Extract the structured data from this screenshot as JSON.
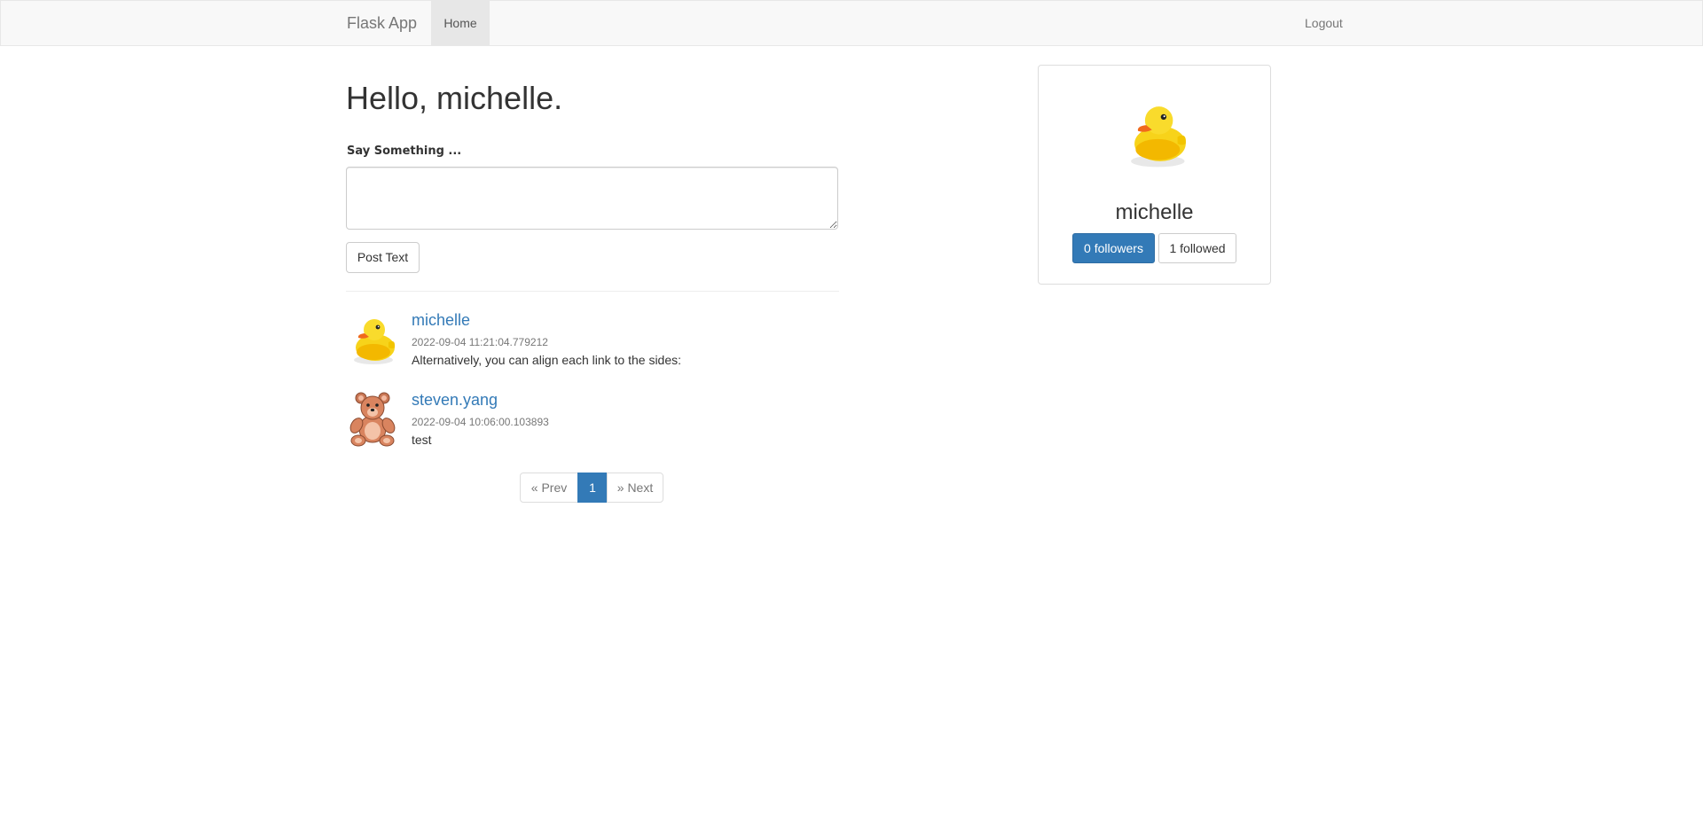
{
  "navbar": {
    "brand": "Flask App",
    "home_label": "Home",
    "logout_label": "Logout"
  },
  "main": {
    "greeting": "Hello, michelle.",
    "form_label": "Say Something ...",
    "textarea_value": "",
    "post_button_label": "Post Text"
  },
  "posts": [
    {
      "author": "michelle",
      "timestamp": "2022-09-04 11:21:04.779212",
      "body": "Alternatively, you can align each link to the sides:",
      "avatar_icon": "rubber-duck-icon"
    },
    {
      "author": "steven.yang",
      "timestamp": "2022-09-04 10:06:00.103893",
      "body": "test",
      "avatar_icon": "teddy-bear-icon"
    }
  ],
  "pagination": {
    "prev_label": "« Prev",
    "current_page": "1",
    "next_label": "» Next"
  },
  "profile": {
    "username": "michelle",
    "avatar_icon": "rubber-duck-icon",
    "followers_label": "0 followers",
    "followed_label": "1 followed"
  },
  "colors": {
    "link": "#337ab7",
    "primary": "#337ab7",
    "navbar_bg": "#f8f8f8",
    "nav_active_bg": "#e7e7e7"
  }
}
